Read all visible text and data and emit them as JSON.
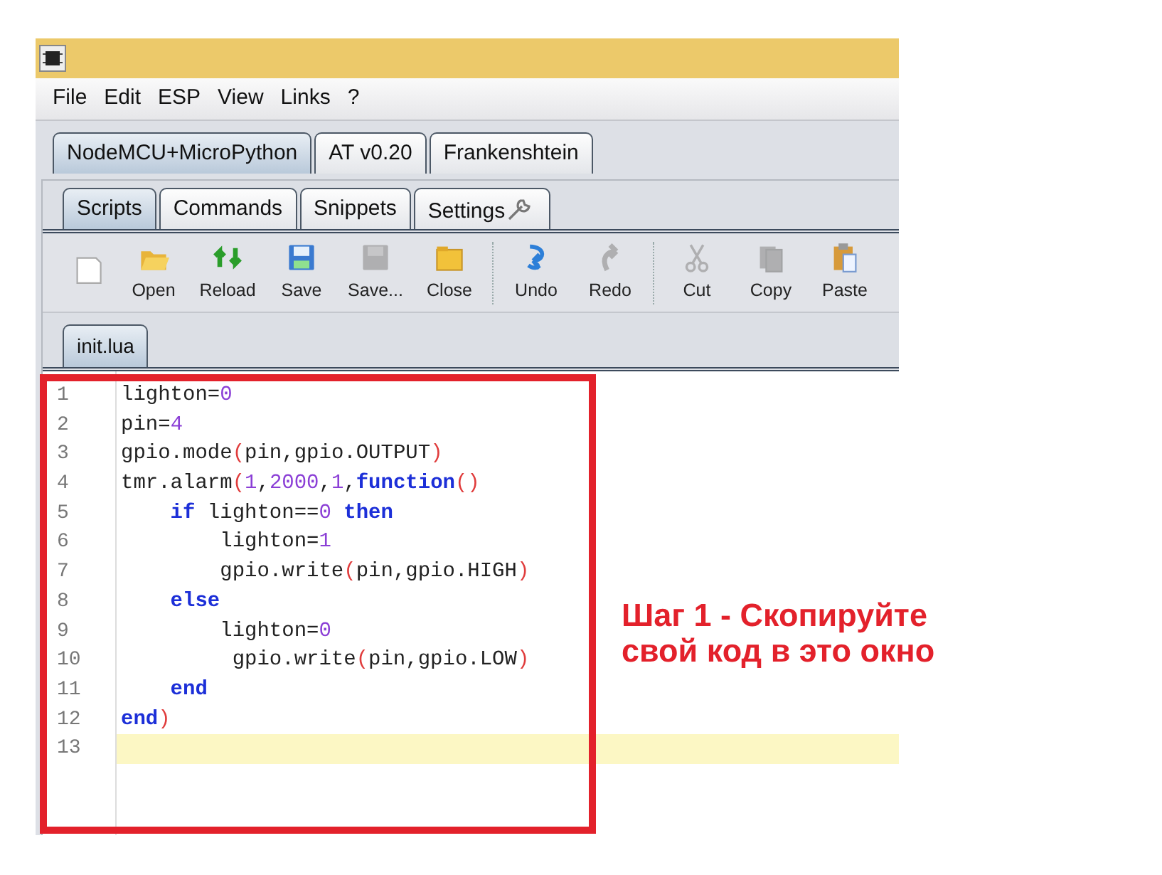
{
  "menu": [
    "File",
    "Edit",
    "ESP",
    "View",
    "Links",
    "?"
  ],
  "main_tabs": [
    {
      "label": "NodeMCU+MicroPython",
      "selected": true
    },
    {
      "label": "AT v0.20",
      "selected": false
    },
    {
      "label": "Frankenshtein",
      "selected": false
    }
  ],
  "sub_tabs": [
    {
      "label": "Scripts",
      "selected": true,
      "kind": "text"
    },
    {
      "label": "Commands",
      "selected": false,
      "kind": "text"
    },
    {
      "label": "Snippets",
      "selected": false,
      "kind": "text"
    },
    {
      "label": "Settings",
      "selected": false,
      "kind": "wrench"
    }
  ],
  "toolbar": [
    {
      "kind": "new",
      "disabled": false
    },
    {
      "kind": "open",
      "label": "Open",
      "disabled": false
    },
    {
      "kind": "reload",
      "label": "Reload",
      "disabled": false
    },
    {
      "kind": "save",
      "label": "Save",
      "disabled": false
    },
    {
      "kind": "saveas",
      "label": "Save...",
      "disabled": true
    },
    {
      "kind": "close",
      "label": "Close",
      "disabled": false
    },
    {
      "kind": "sep"
    },
    {
      "kind": "undo",
      "label": "Undo",
      "disabled": false
    },
    {
      "kind": "redo",
      "label": "Redo",
      "disabled": true
    },
    {
      "kind": "sep"
    },
    {
      "kind": "cut",
      "label": "Cut",
      "disabled": true
    },
    {
      "kind": "copy",
      "label": "Copy",
      "disabled": true
    },
    {
      "kind": "paste",
      "label": "Paste",
      "disabled": false
    }
  ],
  "file_tabs": [
    {
      "label": "init.lua",
      "selected": true
    }
  ],
  "editor": {
    "lines": [
      {
        "number": "1",
        "tokens": [
          {
            "text": "lighton=",
            "kind": "plain"
          },
          {
            "text": "0",
            "kind": "num"
          }
        ]
      },
      {
        "number": "2",
        "tokens": [
          {
            "text": "pin=",
            "kind": "plain"
          },
          {
            "text": "4",
            "kind": "num"
          }
        ]
      },
      {
        "number": "3",
        "tokens": [
          {
            "text": "gpio.mode",
            "kind": "plain"
          },
          {
            "text": "(",
            "kind": "paren"
          },
          {
            "text": "pin,gpio.OUTPUT",
            "kind": "plain"
          },
          {
            "text": ")",
            "kind": "paren"
          }
        ]
      },
      {
        "number": "4",
        "tokens": [
          {
            "text": "tmr.alarm",
            "kind": "plain"
          },
          {
            "text": "(",
            "kind": "paren"
          },
          {
            "text": "1",
            "kind": "num"
          },
          {
            "text": ",",
            "kind": "plain"
          },
          {
            "text": "2000",
            "kind": "num"
          },
          {
            "text": ",",
            "kind": "plain"
          },
          {
            "text": "1",
            "kind": "num"
          },
          {
            "text": ",",
            "kind": "plain"
          },
          {
            "text": "function",
            "kind": "kw"
          },
          {
            "text": "()",
            "kind": "paren"
          }
        ]
      },
      {
        "number": "5",
        "tokens": [
          {
            "text": "    if",
            "kind": "kw"
          },
          {
            "text": " lighton==",
            "kind": "plain"
          },
          {
            "text": "0",
            "kind": "num"
          },
          {
            "text": " then",
            "kind": "kw"
          }
        ]
      },
      {
        "number": "6",
        "tokens": [
          {
            "text": "        lighton=",
            "kind": "plain"
          },
          {
            "text": "1",
            "kind": "num"
          }
        ]
      },
      {
        "number": "7",
        "tokens": [
          {
            "text": "        gpio.write",
            "kind": "plain"
          },
          {
            "text": "(",
            "kind": "paren"
          },
          {
            "text": "pin,gpio.HIGH",
            "kind": "plain"
          },
          {
            "text": ")",
            "kind": "paren"
          }
        ]
      },
      {
        "number": "8",
        "tokens": [
          {
            "text": "    else",
            "kind": "kw"
          }
        ]
      },
      {
        "number": "9",
        "tokens": [
          {
            "text": "        lighton=",
            "kind": "plain"
          },
          {
            "text": "0",
            "kind": "num"
          }
        ]
      },
      {
        "number": "10",
        "tokens": [
          {
            "text": "         gpio.write",
            "kind": "plain"
          },
          {
            "text": "(",
            "kind": "paren"
          },
          {
            "text": "pin,gpio.LOW",
            "kind": "plain"
          },
          {
            "text": ")",
            "kind": "paren"
          }
        ]
      },
      {
        "number": "11",
        "tokens": [
          {
            "text": "    end",
            "kind": "kw"
          }
        ]
      },
      {
        "number": "12",
        "tokens": [
          {
            "text": "end",
            "kind": "kw"
          },
          {
            "text": ")",
            "kind": "paren"
          }
        ]
      },
      {
        "number": "13",
        "current": true
      }
    ]
  },
  "annotation": "Шаг 1 - Скопируйте свой код в это окно"
}
